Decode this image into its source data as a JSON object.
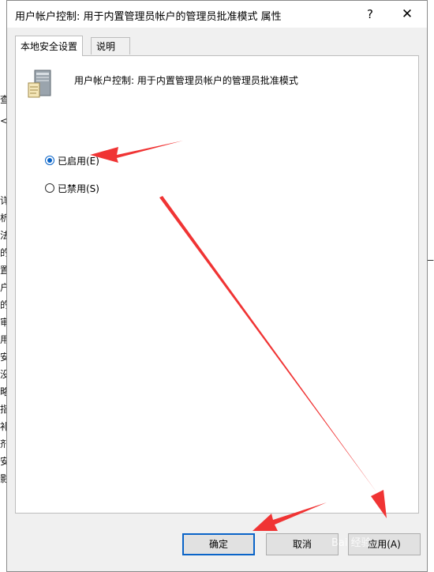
{
  "background": {
    "left_fragments": [
      "查",
      "<",
      "详",
      "析",
      "法",
      "的",
      "置",
      "户",
      "的",
      "审",
      "用",
      "安",
      "没",
      "略",
      "指",
      "补",
      "剂",
      "安",
      "影"
    ],
    "right_fragments": [
      "—"
    ]
  },
  "dialog": {
    "title": "用户帐户控制: 用于内置管理员帐户的管理员批准模式 属性",
    "help_glyph": "?",
    "close_glyph": "✕",
    "tabs": [
      {
        "label": "本地安全设置",
        "active": true
      },
      {
        "label": "说明",
        "active": false
      }
    ],
    "policy_title": "用户帐户控制: 用于内置管理员帐户的管理员批准模式",
    "policy_icon": "server-policy-icon",
    "options": [
      {
        "label": "已启用(E)",
        "checked": true
      },
      {
        "label": "已禁用(S)",
        "checked": false
      }
    ],
    "buttons": {
      "ok": "确定",
      "cancel": "取消",
      "apply": "应用(A)"
    }
  },
  "watermark": "Bai 经验",
  "colors": {
    "accent": "#0a64c8",
    "annotation_arrow": "#f03434"
  }
}
